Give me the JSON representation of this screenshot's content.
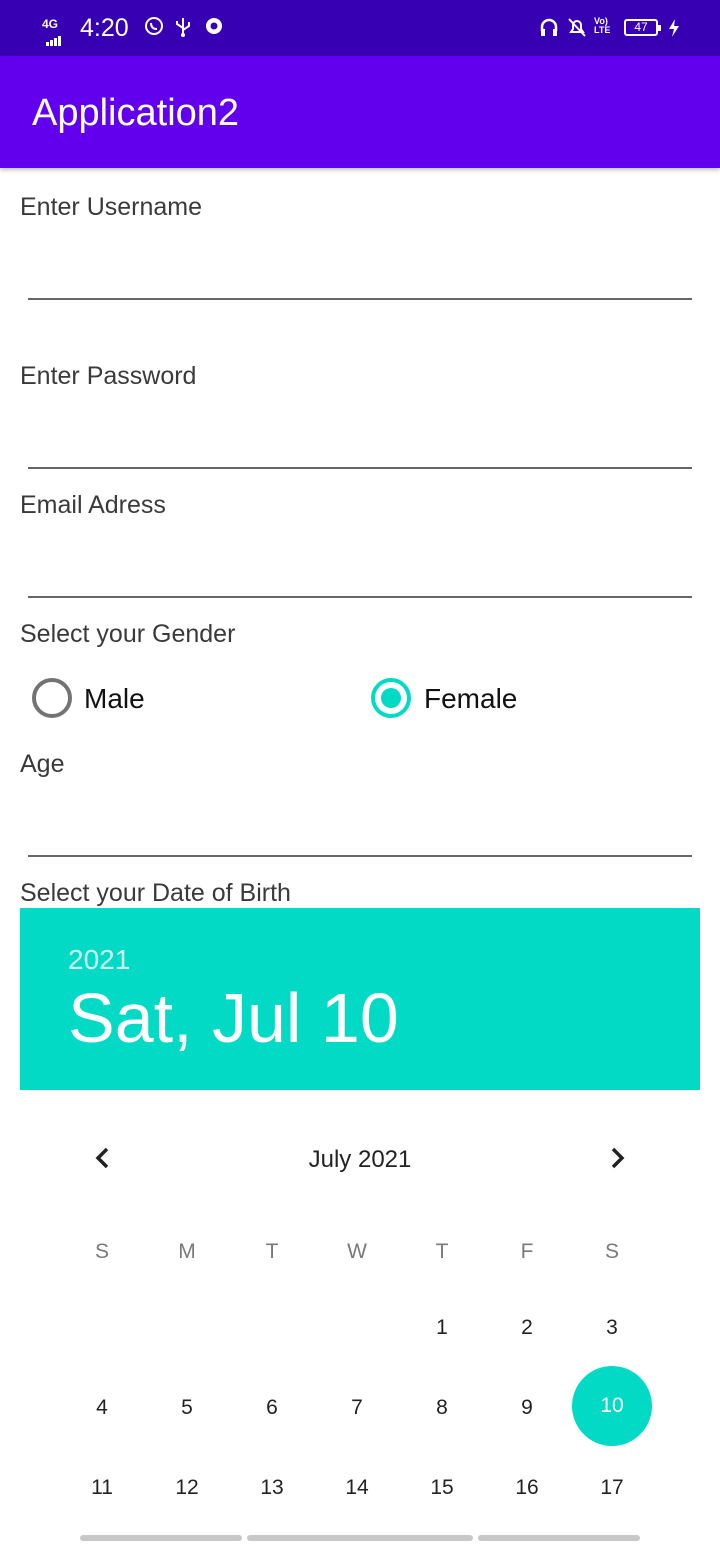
{
  "status_bar": {
    "network": "4G",
    "time": "4:20",
    "battery": "47",
    "icons": [
      "whatsapp-icon",
      "usb-icon",
      "chrome-icon",
      "headphones-icon",
      "bell-off-icon",
      "volte-icon",
      "battery-icon",
      "charging-icon"
    ],
    "volte_top": "Vo)",
    "volte_bottom": "LTE"
  },
  "app_bar": {
    "title": "Application2"
  },
  "form": {
    "username_label": "Enter Username",
    "username_value": "",
    "password_label": "Enter Password",
    "password_value": "",
    "email_label": "Email Adress",
    "email_value": "",
    "gender_label": "Select your Gender",
    "gender_options": [
      {
        "label": "Male",
        "selected": false
      },
      {
        "label": "Female",
        "selected": true
      }
    ],
    "age_label": "Age",
    "age_value": "",
    "dob_label": "Select your Date of Birth"
  },
  "date_picker": {
    "year": "2021",
    "selected_date": "Sat, Jul 10",
    "month_title": "July 2021",
    "weekdays": [
      "S",
      "M",
      "T",
      "W",
      "T",
      "F",
      "S"
    ],
    "weeks": [
      [
        "",
        "",
        "",
        "",
        "1",
        "2",
        "3"
      ],
      [
        "4",
        "5",
        "6",
        "7",
        "8",
        "9",
        "10"
      ],
      [
        "11",
        "12",
        "13",
        "14",
        "15",
        "16",
        "17"
      ]
    ],
    "selected_day": "10"
  },
  "colors": {
    "status_bar": "#3700b3",
    "app_bar": "#6200ee",
    "accent": "#03dac5"
  }
}
